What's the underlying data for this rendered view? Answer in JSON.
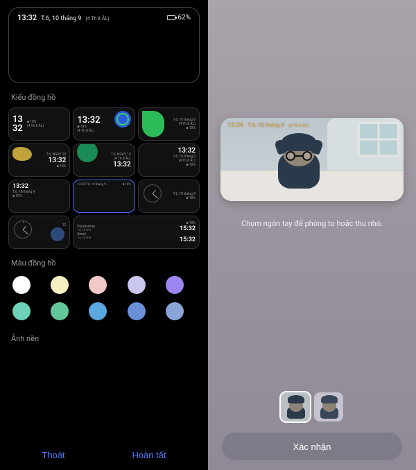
{
  "left": {
    "preview": {
      "time": "13:32",
      "date": "T.6, 10 tháng 9",
      "lunar": "(4 Th 8 ÂL)",
      "battery": "62%"
    },
    "sections": {
      "clock_style": "Kiểu đồng hồ",
      "clock_color": "Màu đồng hồ",
      "wallpaper": "Ảnh nền"
    },
    "styles": [
      {
        "id": "stacked-big",
        "time1": "13",
        "time2": "32",
        "pct": "10%",
        "sub": "(4 Th 8 ÂL)"
      },
      {
        "id": "time-shape-right",
        "time": "13:32",
        "pct": "10%",
        "sub": "(4 Th 8 ÂL)"
      },
      {
        "id": "shape-left-date",
        "date": "T.6, 10 tháng 9",
        "sub": "(4 Th 8 ÂL)",
        "pct": "10%"
      },
      {
        "id": "leaf-time",
        "date": "T.6, NGÀY 10",
        "time": "13:32",
        "pct": "10%"
      },
      {
        "id": "arc-time",
        "date": "T.6, NGÀY 10",
        "sub": "(4 Th 8 ÂL)",
        "time": "13:32",
        "pct": "10%"
      },
      {
        "id": "right-align",
        "time": "13:32",
        "date": "T.6, 10 tháng 9",
        "sub": "(4 Th 8 ÂL)",
        "pct": "10%"
      },
      {
        "id": "wide-date-time",
        "time": "13:32",
        "date": "T.6, 10 tháng 9",
        "pct": "10%",
        "sub": "10%"
      },
      {
        "id": "tiny-bar",
        "text": "13:32  T.6, 10 tháng 9…",
        "pct": "10%"
      },
      {
        "id": "analog-date",
        "date": "T.6, 10 tháng 9",
        "pct": "10%"
      },
      {
        "id": "analog-only",
        "num": "12"
      },
      {
        "id": "world-clock",
        "city1": "Địa phương",
        "time1": "15:32",
        "city2": "Seoul",
        "time2": "15:32",
        "sub1": "T.6, 10 TH9",
        "sub2": "T.6, 10 TH9",
        "pct": "10%"
      }
    ],
    "colors": [
      "#ffffff",
      "#f4eec1",
      "#f2c9c6",
      "#c9c6f0",
      "#9d86f2",
      "#6dd3b8",
      "#63c79c",
      "#5ba7e0",
      "#6a8fd8",
      "#8aa4d8"
    ],
    "buttons": {
      "exit": "Thoát",
      "done": "Hoàn tất"
    }
  },
  "right": {
    "preview": {
      "time": "13:34",
      "date": "T.6, 10 tháng 9",
      "lunar": "(4 Th 8 ÂL)"
    },
    "instruction": "Chụm ngón tay để phóng to hoặc thu nhỏ.",
    "confirm": "Xác nhận"
  }
}
